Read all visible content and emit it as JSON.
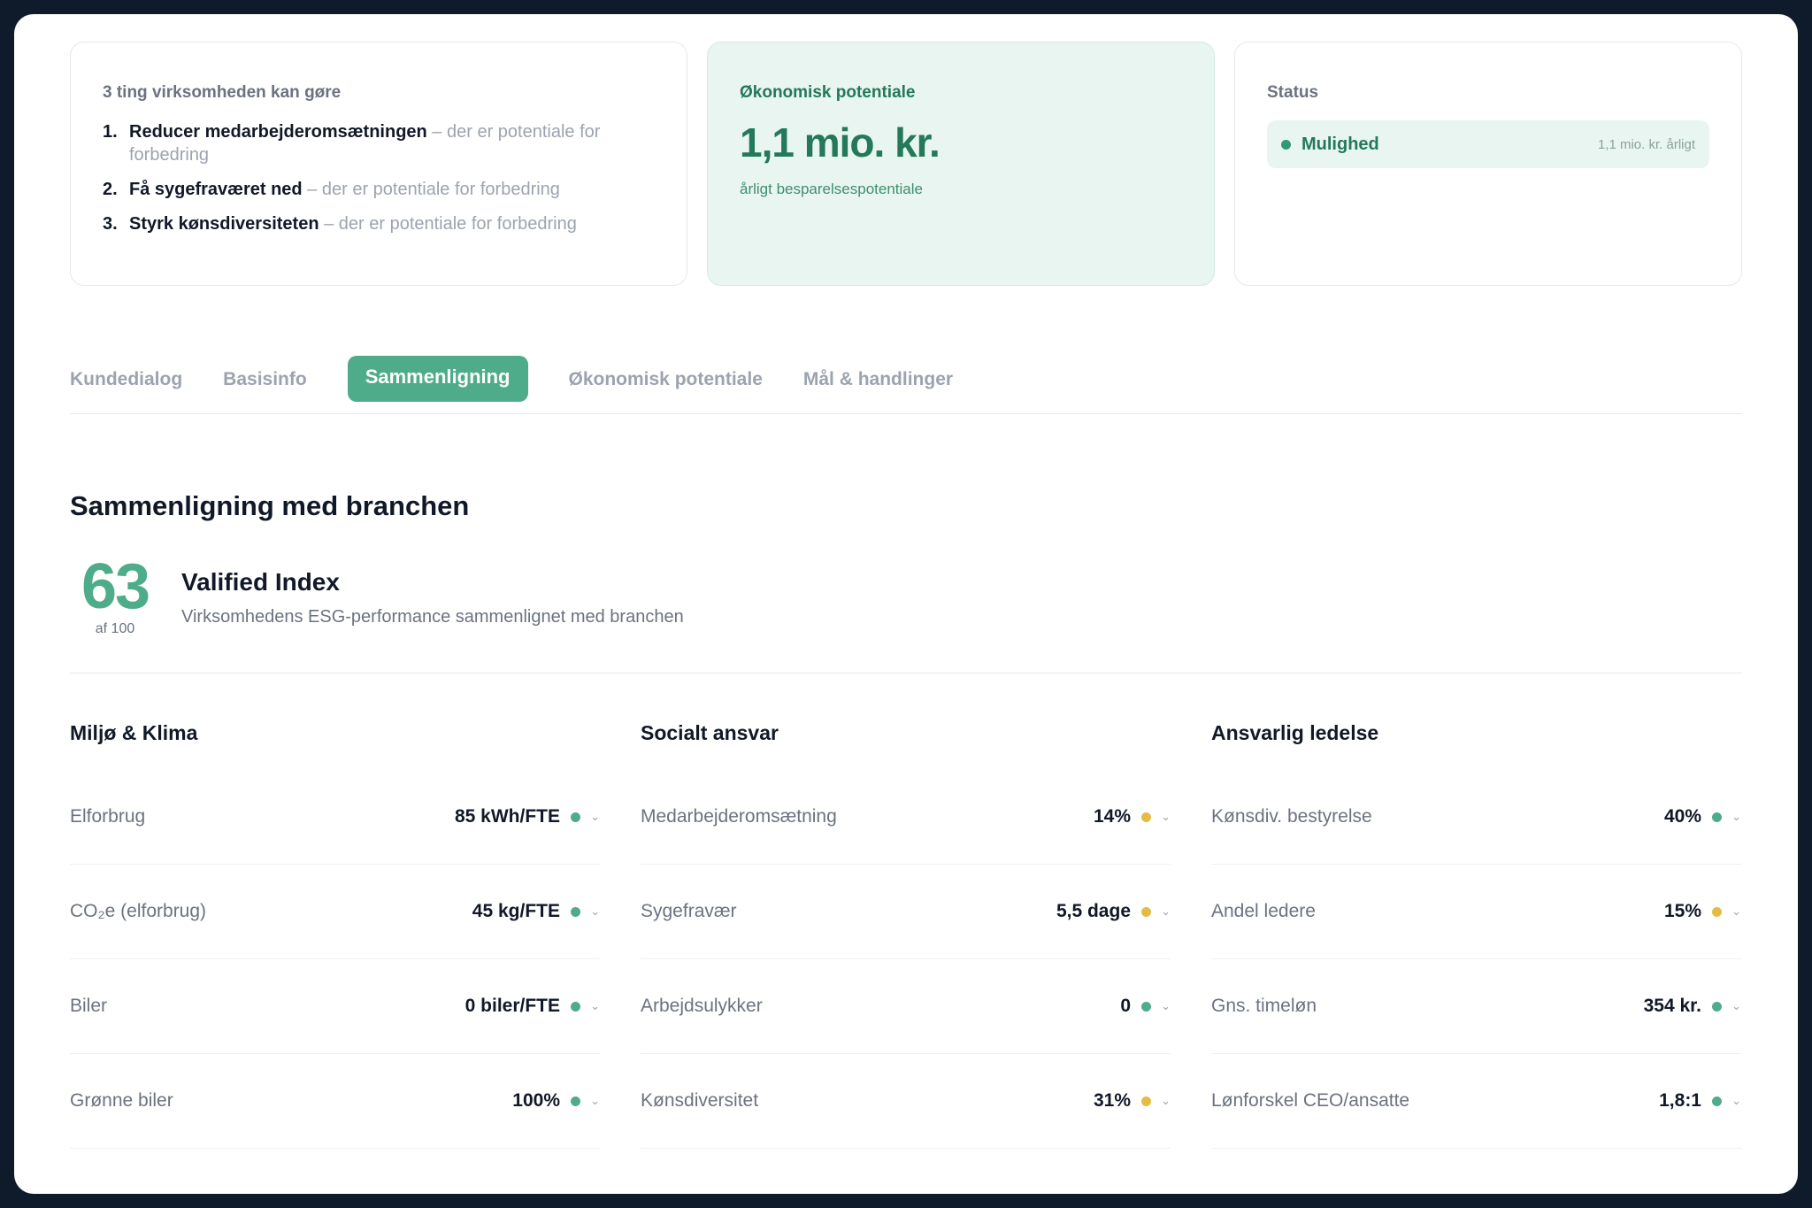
{
  "colors": {
    "accent": "#4fac8a",
    "accent_dark": "#23795a",
    "status_green": "#4fac8a",
    "status_yellow": "#e6bb43",
    "frame": "#0f1b2a"
  },
  "actions_card": {
    "title": "3 ting virksomheden kan gøre",
    "items": [
      {
        "num": "1.",
        "main": "Reducer medarbejderomsætningen",
        "rest": " – der er potentiale for forbedring"
      },
      {
        "num": "2.",
        "main": "Få sygefraværet ned",
        "rest": " – der er potentiale for forbedring"
      },
      {
        "num": "3.",
        "main": "Styrk kønsdiversiteten",
        "rest": " – der er potentiale for forbedring"
      }
    ]
  },
  "potential_card": {
    "title": "Økonomisk potentiale",
    "amount": "1,1 mio. kr.",
    "subtitle": "årligt besparelsespotentiale"
  },
  "status_card": {
    "title": "Status",
    "label": "Mulighed",
    "amount": "1,1 mio. kr. årligt"
  },
  "tabs": [
    {
      "label": "Kundedialog",
      "active": false
    },
    {
      "label": "Basisinfo",
      "active": false
    },
    {
      "label": "Sammenligning",
      "active": true
    },
    {
      "label": "Økonomisk potentiale",
      "active": false
    },
    {
      "label": "Mål & handlinger",
      "active": false
    }
  ],
  "section": {
    "title": "Sammenligning med branchen",
    "index": {
      "score": "63",
      "of": "af 100",
      "name": "Valified Index",
      "description": "Virksomhedens ESG-performance sammenlignet med branchen"
    }
  },
  "columns": [
    {
      "title": "Miljø & Klima",
      "rows": [
        {
          "label": "Elforbrug",
          "value": "85 kWh/FTE",
          "status": "green"
        },
        {
          "label": "CO₂e (elforbrug)",
          "value": "45 kg/FTE",
          "status": "green"
        },
        {
          "label": "Biler",
          "value": "0 biler/FTE",
          "status": "green"
        },
        {
          "label": "Grønne biler",
          "value": "100%",
          "status": "green"
        }
      ]
    },
    {
      "title": "Socialt ansvar",
      "rows": [
        {
          "label": "Medarbejderomsætning",
          "value": "14%",
          "status": "yellow"
        },
        {
          "label": "Sygefravær",
          "value": "5,5 dage",
          "status": "yellow"
        },
        {
          "label": "Arbejdsulykker",
          "value": "0",
          "status": "green"
        },
        {
          "label": "Kønsdiversitet",
          "value": "31%",
          "status": "yellow"
        }
      ]
    },
    {
      "title": "Ansvarlig ledelse",
      "rows": [
        {
          "label": "Kønsdiv. bestyrelse",
          "value": "40%",
          "status": "green"
        },
        {
          "label": "Andel ledere",
          "value": "15%",
          "status": "yellow"
        },
        {
          "label": "Gns. timeløn",
          "value": "354 kr.",
          "status": "green"
        },
        {
          "label": "Lønforskel CEO/ansatte",
          "value": "1,8:1",
          "status": "green"
        }
      ]
    }
  ],
  "icons": {
    "chevron": "chevron-down-icon",
    "status_dot": "status-dot-icon"
  }
}
